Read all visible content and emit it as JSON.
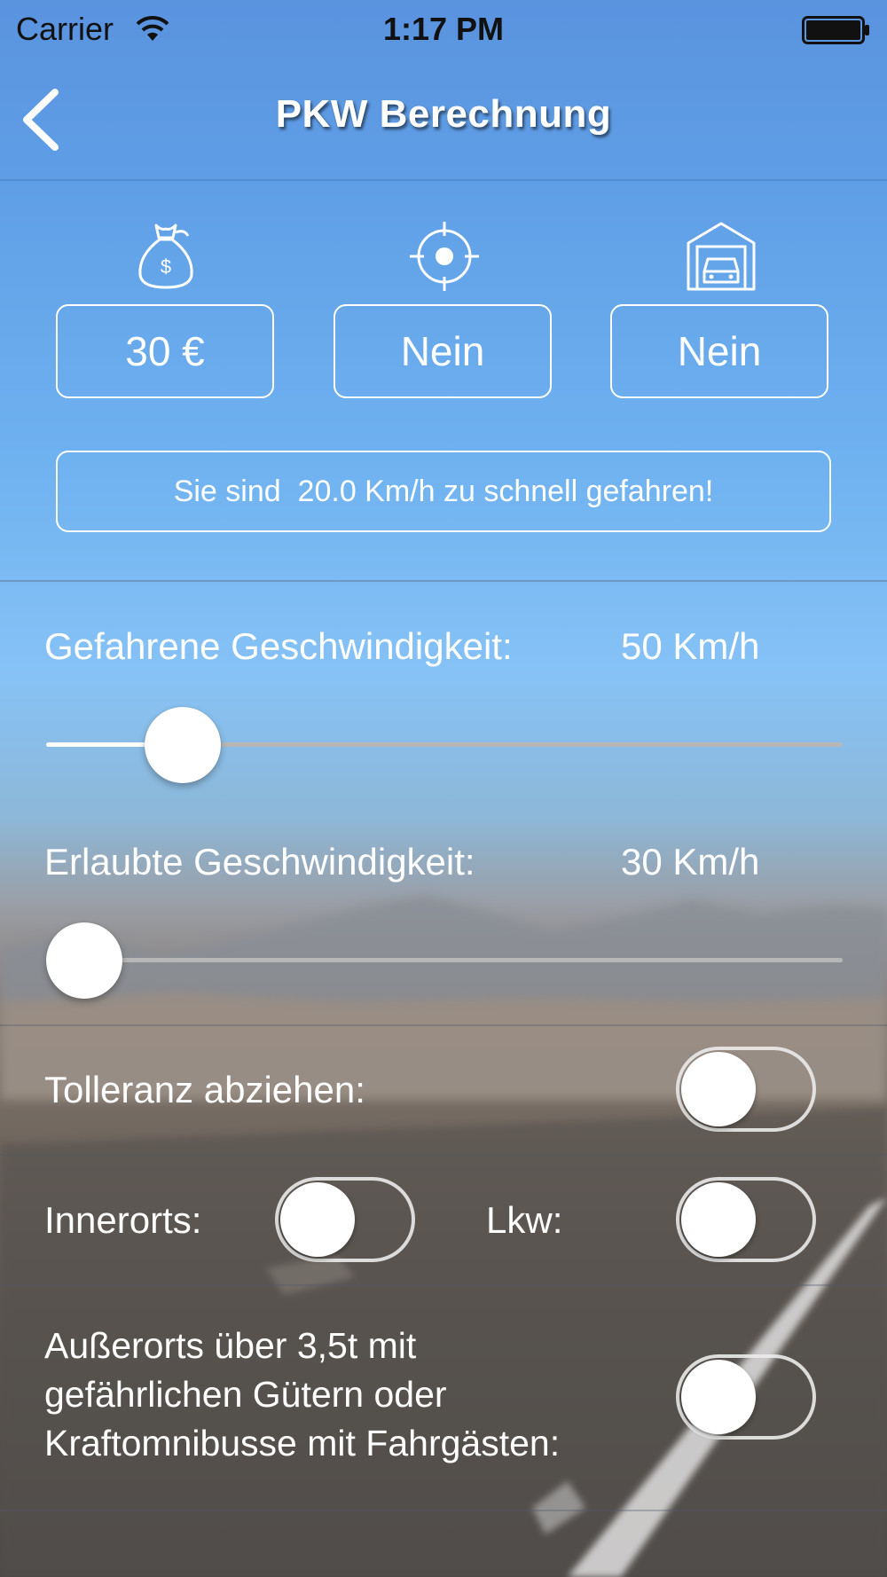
{
  "status_bar": {
    "carrier": "Carrier",
    "time": "1:17 PM",
    "wifi_icon": "wifi-icon",
    "battery_icon": "battery-full-icon"
  },
  "nav": {
    "title": "PKW Berechnung",
    "back_icon": "chevron-left-icon"
  },
  "summary": {
    "fine": {
      "icon": "money-bag-icon",
      "value": "30 €"
    },
    "points": {
      "icon": "target-icon",
      "value": "Nein"
    },
    "driving_ban": {
      "icon": "garage-car-icon",
      "value": "Nein"
    },
    "message": "Sie sind  20.0 Km/h zu schnell gefahren!"
  },
  "driven_speed": {
    "label": "Gefahrene Geschwindigkeit:",
    "value": "50 Km/h",
    "slider_fraction": 0.137
  },
  "allowed_speed": {
    "label": "Erlaubte Geschwindigkeit:",
    "value": "30 Km/h",
    "slider_fraction": 0.0
  },
  "toggles": {
    "tolerance": {
      "label": "Tolleranz abziehen:",
      "on": false
    },
    "urban": {
      "label": "Innerorts:",
      "on": false
    },
    "truck": {
      "label": "Lkw:",
      "on": false
    },
    "heavy": {
      "label": "Außerorts über 3,5t mit\ngefährlichen Gütern oder\nKraftomnibusse mit Fahrgästen:",
      "on": false
    }
  }
}
